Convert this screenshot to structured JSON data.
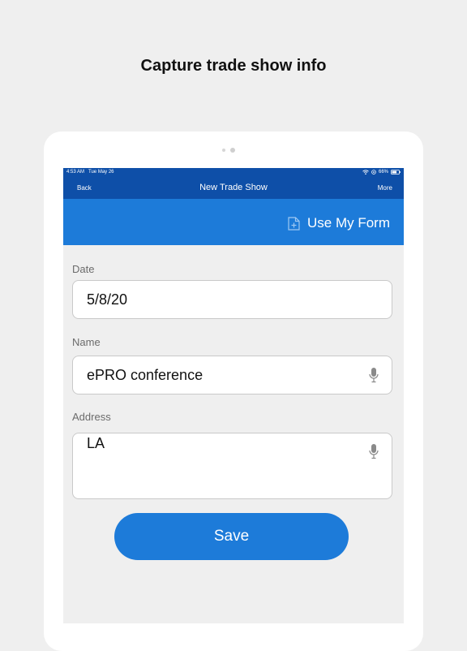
{
  "headline": "Capture trade show info",
  "status_bar": {
    "time": "4:53 AM",
    "date": "Tue May 26",
    "battery": "66%"
  },
  "nav": {
    "back_label": "Back",
    "title": "New Trade Show",
    "more_label": "More"
  },
  "banner": {
    "use_form_label": "Use My Form",
    "icon": "add-document-icon"
  },
  "form": {
    "date": {
      "label": "Date",
      "value": "5/8/20"
    },
    "name": {
      "label": "Name",
      "value": "ePRO conference",
      "icon": "microphone-icon"
    },
    "address": {
      "label": "Address",
      "value": "LA",
      "icon": "microphone-icon"
    }
  },
  "save_label": "Save",
  "colors": {
    "nav_blue": "#0e4fa8",
    "accent_blue": "#1d7bd9",
    "background": "#efefef"
  }
}
